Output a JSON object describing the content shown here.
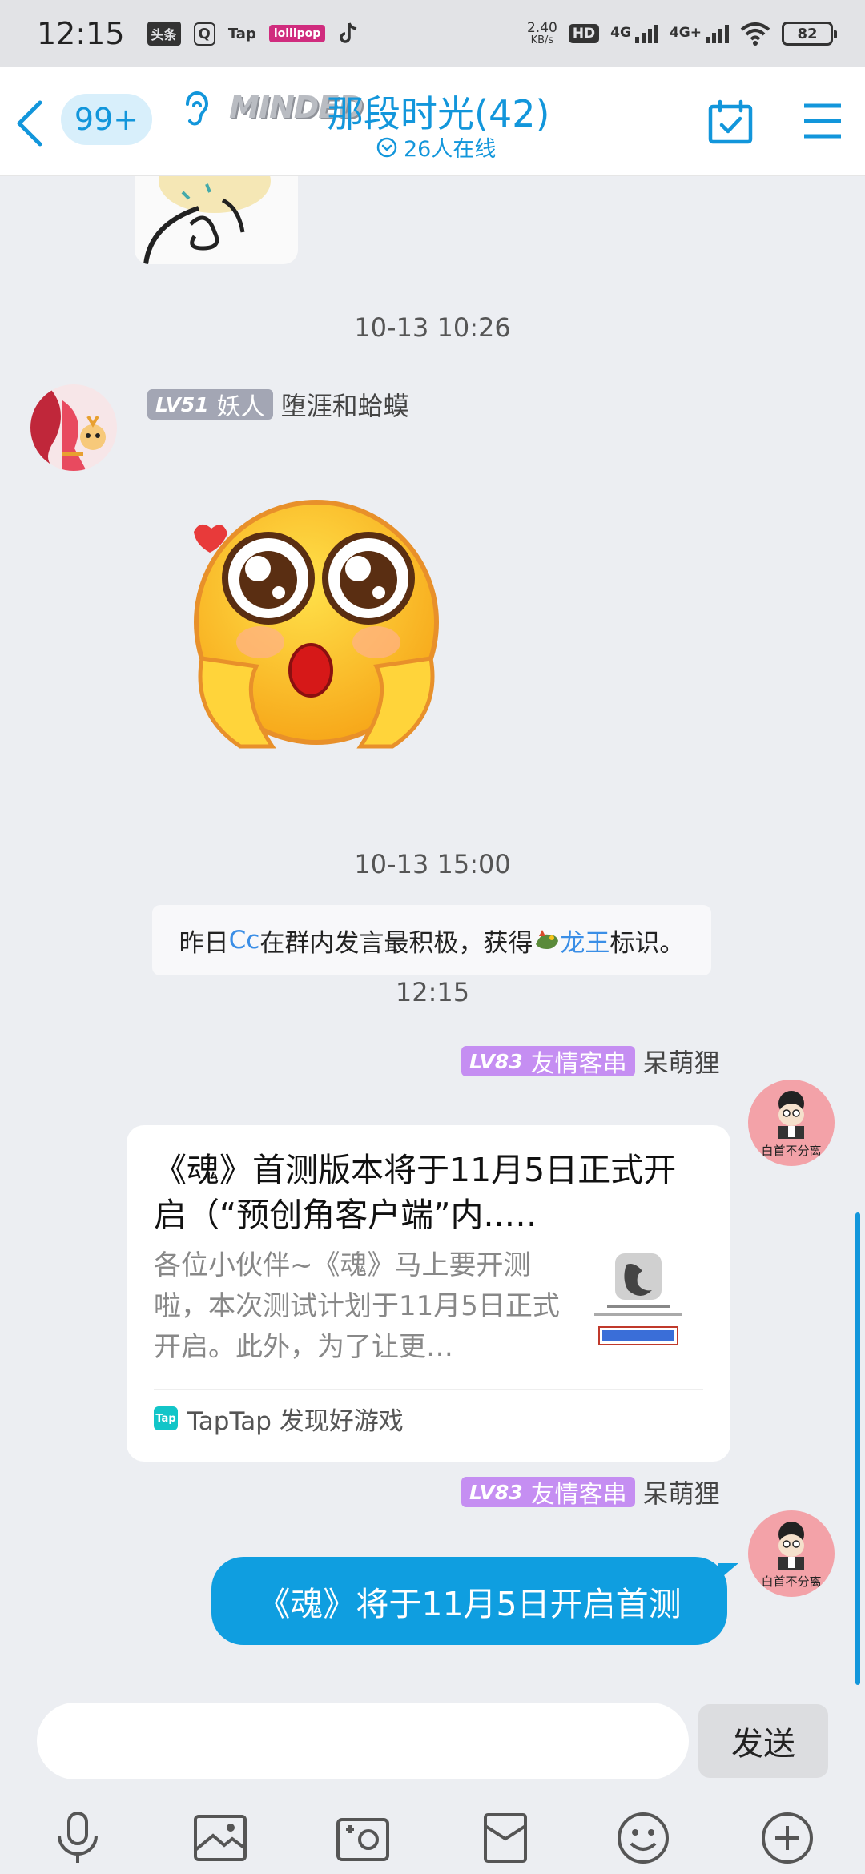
{
  "status_bar": {
    "time": "12:15",
    "apps": [
      "头条",
      "Q",
      "Tap",
      "lollipop",
      "tiktok"
    ],
    "net_speed_value": "2.40",
    "net_speed_unit": "KB/s",
    "hd": "HD",
    "sim1": "4G",
    "sim2": "4G+",
    "battery": "82"
  },
  "header": {
    "unread_count": "99+",
    "group_logo_text": "MINDED",
    "group_name": "那段时光(42)",
    "online_text": "26人在线"
  },
  "messages": {
    "ts1": "10-13 10:26",
    "msg1": {
      "level": "LV51",
      "title": "妖人",
      "sender": "堕涯和蛤蟆",
      "emoji": "flushed-hands-emoji"
    },
    "ts2": "10-13 15:00",
    "notice": {
      "pre": "昨日",
      "user": "Cc",
      "mid": "在群内发言最积极，获得",
      "badge": "龙王",
      "post": "标识。"
    },
    "ts3": "12:15",
    "msg2": {
      "level": "LV83",
      "title": "友情客串",
      "sender": "呆萌狸",
      "card_title": "《魂》首测版本将于11月5日正式开启（“预创角客户端”内..…",
      "card_desc": "各位小伙伴~《魂》马上要开测啦，本次测试计划于11月5日正式开启。此外，为了让更…",
      "source_icon": "Tap",
      "source": "TapTap 发现好游戏"
    },
    "msg3": {
      "level": "LV83",
      "title": "友情客串",
      "sender": "呆萌狸",
      "text": "《魂》将于11月5日开启首测"
    }
  },
  "avatar_caption": "白首不分离",
  "input": {
    "placeholder": "",
    "send_label": "发送"
  },
  "colors": {
    "accent": "#1296db",
    "bubble": "#0f9ee0",
    "background": "#eceef2",
    "badge_grey": "#a3a6b4",
    "badge_purple": "#c58ef2"
  }
}
